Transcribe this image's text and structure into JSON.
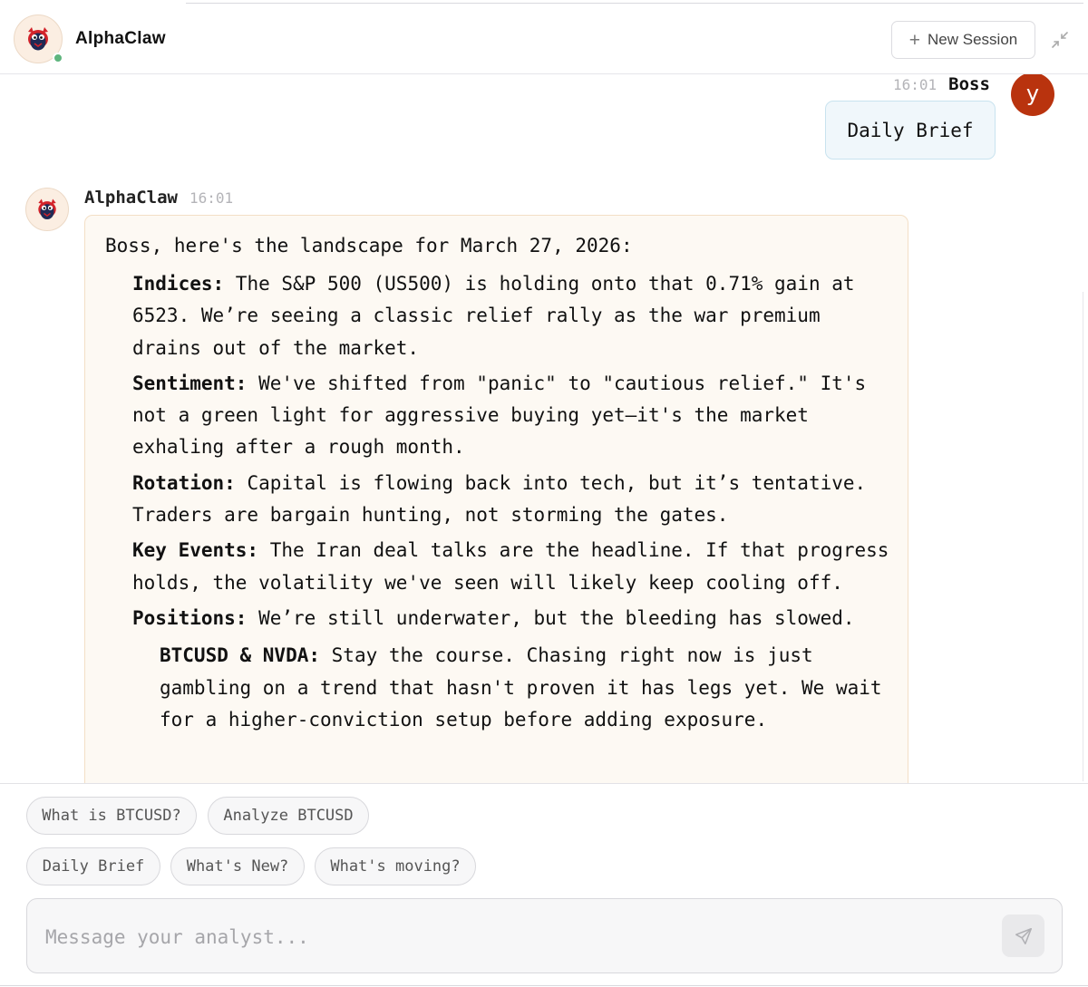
{
  "header": {
    "app_title": "AlphaClaw",
    "new_session_label": "New Session",
    "icons": {
      "logo": "alphaclaw-mascot-icon",
      "online": "online-status-icon",
      "plus": "plus-icon",
      "collapse": "collapse-icon"
    }
  },
  "user_message": {
    "timestamp": "16:01",
    "sender": "Boss",
    "avatar_letter": "y",
    "avatar_color": "#b9330e",
    "text": "Daily Brief"
  },
  "bot_message": {
    "sender": "AlphaClaw",
    "timestamp": "16:01",
    "intro": "Boss, here's the landscape for March 27, 2026:",
    "items": [
      {
        "label": "Indices:",
        "text": " The S&P 500 (US500) is holding onto that 0.71% gain at 6523. We’re seeing a classic relief rally as the war premium drains out of the market."
      },
      {
        "label": "Sentiment:",
        "text": " We've shifted from \"panic\" to \"cautious relief.\" It's not a green light for aggressive buying yet—it's the market exhaling after a rough month."
      },
      {
        "label": "Rotation:",
        "text": " Capital is flowing back into tech, but it’s tentative. Traders are bargain hunting, not storming the gates."
      },
      {
        "label": "Key Events:",
        "text": " The Iran deal talks are the headline. If that progress holds, the volatility we've seen will likely keep cooling off."
      },
      {
        "label": "Positions:",
        "text": " We’re still underwater, but the bleeding has slowed."
      }
    ],
    "subitem": {
      "label": "BTCUSD & NVDA:",
      "text": " Stay the course. Chasing right now is just gambling on a trend that hasn't proven it has legs yet. We wait for a higher-conviction setup before adding exposure."
    }
  },
  "suggestions": [
    "What is BTCUSD?",
    "Analyze BTCUSD",
    "Daily Brief",
    "What's New?",
    "What's moving?"
  ],
  "composer": {
    "placeholder": "Message your analyst...",
    "value": "",
    "send_icon": "send-icon"
  },
  "colors": {
    "bot_bubble_bg": "#fdf9f3",
    "bot_bubble_border": "#f3dfc6",
    "user_bubble_bg": "#f0f7fb",
    "user_bubble_border": "#c9e3ef",
    "online_dot": "#5fb57e"
  }
}
